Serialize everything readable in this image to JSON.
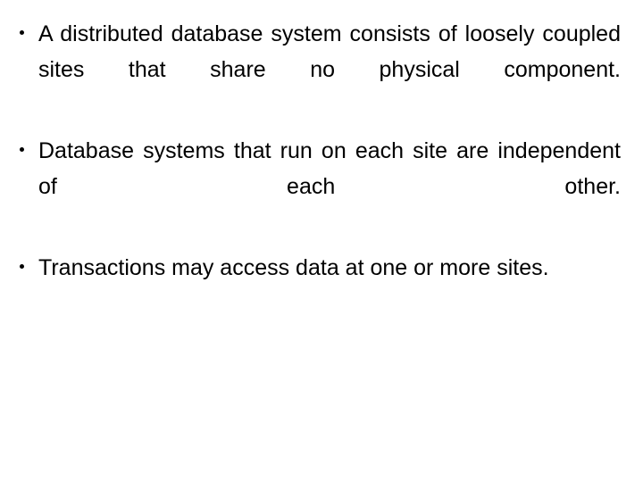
{
  "slide": {
    "background_color": "#ffffff",
    "text_color": "#000000",
    "bullet_glyph": "•",
    "bullets": [
      {
        "id": "bullet-1",
        "text": "A distributed database system consists of loosely coupled sites that share no physical component."
      },
      {
        "id": "bullet-2",
        "text": "Database systems that run on each site are independent of each other."
      },
      {
        "id": "bullet-3",
        "text": "Transactions may access data at one or more sites."
      }
    ]
  }
}
